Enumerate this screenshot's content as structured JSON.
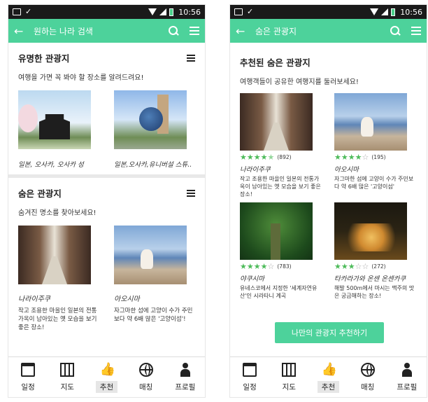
{
  "status": {
    "time": "10:56"
  },
  "screens": [
    {
      "appbar_title": "원하는 나라 검색",
      "sections": [
        {
          "title": "유명한 관광지",
          "subtitle": "여행을 가면 꼭 봐야 할 장소를 알려드려요!",
          "cards": [
            {
              "caption": "일본, 오사카, 오사카 성"
            },
            {
              "caption": "일본,오사카,유니버설 스튜.."
            }
          ]
        },
        {
          "title": "숨은 관광지",
          "subtitle": "숨겨진 명소를 찾아보세요!",
          "cards": [
            {
              "name": "나라이주쿠",
              "desc": "작고 조용한 마을인 일본의 전통가옥이 남아있는 옛 모습을 보기 좋은 장소!"
            },
            {
              "name": "아오시마",
              "desc": "자그마한 섬에 고양이 수가 주민보다 약 6배 많은 '고양이섬'!"
            }
          ]
        }
      ]
    },
    {
      "appbar_title": "숨은 관광지",
      "title": "추천된 숨은 관광지",
      "subtitle": "여행객들이 공유한 여행지를 둘러보세요!",
      "cards": [
        {
          "name": "나라이주쿠",
          "rating": 4.5,
          "count": "(892)",
          "desc": "작고 조용한 마을인 일본의 전통가옥이 남아있는 옛 모습을 보기 좋은 장소!"
        },
        {
          "name": "아오시마",
          "rating": 4,
          "count": "(195)",
          "desc": "자그마한 섬에 고양이 수가 주민보다 약 6배 많은 '고양이섬'"
        },
        {
          "name": "야쿠시마",
          "rating": 4,
          "count": "(783)",
          "desc": "유네스코에서 지정한 '세계자연유산'인 시라타니 계곡"
        },
        {
          "name": "타카라가와 온센 온센카쿠",
          "rating": 3,
          "count": "(272)",
          "desc": "해발 500m에서 마시는 맥주의 맛은 궁금해하는 장소!"
        }
      ],
      "cta_label": "나만의 관광지 추천하기"
    }
  ],
  "nav": [
    {
      "label": "일정",
      "icon": "calendar-icon"
    },
    {
      "label": "지도",
      "icon": "map-icon"
    },
    {
      "label": "추천",
      "icon": "thumbs-up-icon"
    },
    {
      "label": "매칭",
      "icon": "globe-icon"
    },
    {
      "label": "프로필",
      "icon": "person-icon"
    }
  ],
  "active_nav": "추천",
  "colors": {
    "accent": "#4dd29b",
    "star": "#4dbb5a"
  }
}
